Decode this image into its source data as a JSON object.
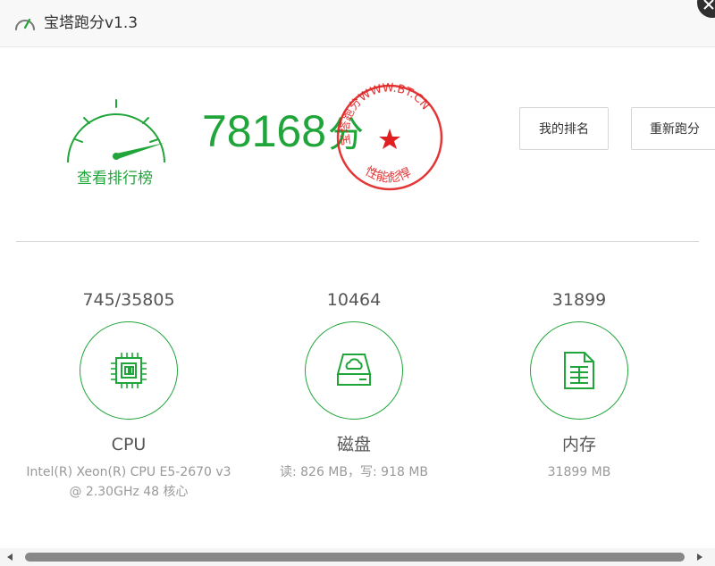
{
  "window": {
    "title": "宝塔跑分v1.3",
    "icon": "speedometer-icon"
  },
  "summary": {
    "rank_link": "查看排行榜",
    "score": "78168",
    "score_unit": "分",
    "seal": {
      "top_text": "宝塔跑分WWW.BT.CN",
      "bottom_text": "性能彪悍",
      "color": "#e02020"
    }
  },
  "buttons": {
    "my_rank": "我的排名",
    "rerun": "重新跑分"
  },
  "metrics": [
    {
      "key": "cpu",
      "score": "745/35805",
      "name": "CPU",
      "detail_line1": "Intel(R) Xeon(R) CPU E5-2670 v3",
      "detail_line2": "@ 2.30GHz 48 核心",
      "icon": "cpu-icon"
    },
    {
      "key": "disk",
      "score": "10464",
      "name": "磁盘",
      "detail_line1": "读: 826 MB，写: 918 MB",
      "detail_line2": "",
      "icon": "disk-icon"
    },
    {
      "key": "memory",
      "score": "31899",
      "name": "内存",
      "detail_line1": "31899 MB",
      "detail_line2": "",
      "icon": "memory-icon"
    }
  ],
  "colors": {
    "accent": "#20a53a",
    "seal": "#e02020"
  }
}
